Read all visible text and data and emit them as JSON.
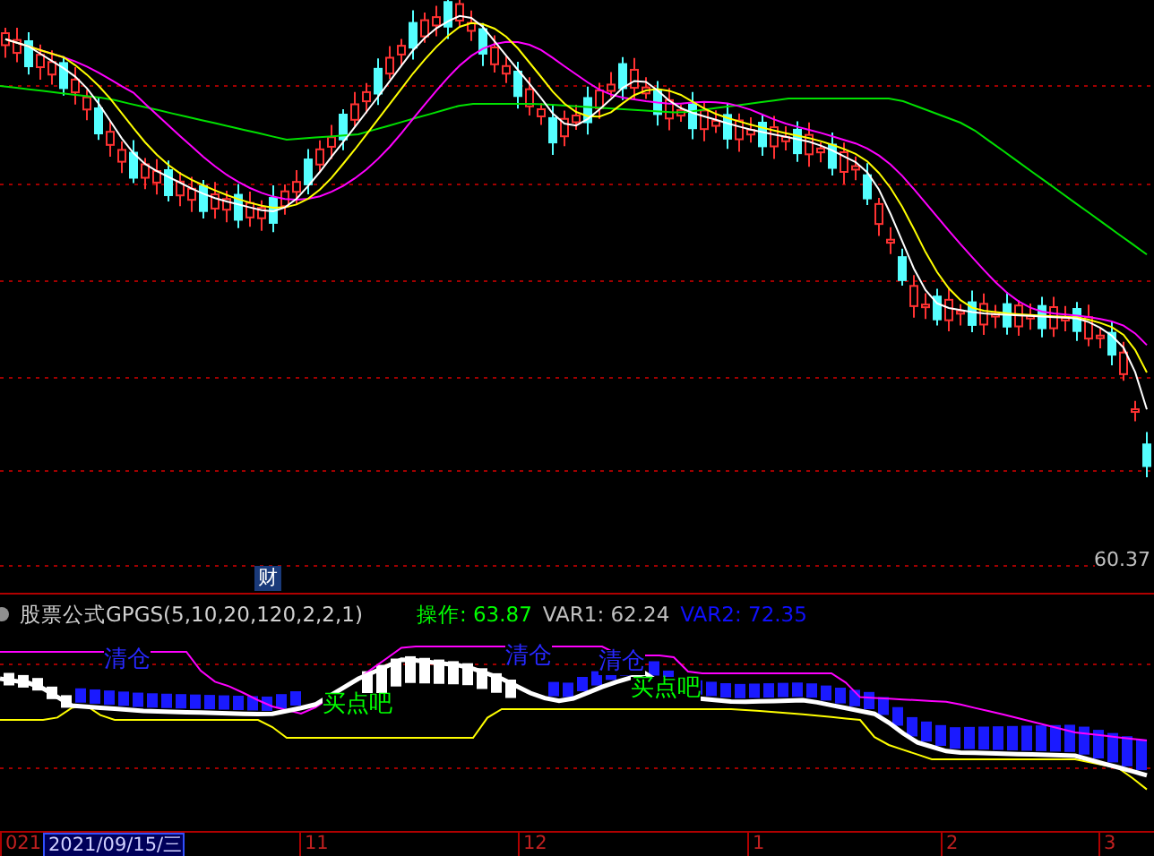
{
  "main_chart": {
    "price_label": "60.37",
    "marker": "财"
  },
  "indicator": {
    "name": "股票公式GPGS(5,10,20,120,2,2,1)",
    "values": [
      {
        "label": "操作: 63.87",
        "color": "#00ff00"
      },
      {
        "label": "VAR1: 62.24",
        "color": "#c0c0c0"
      },
      {
        "label": "VAR2: 72.35",
        "color": "#1010ff"
      }
    ],
    "signals": [
      {
        "text": "清仓",
        "kind": "sell"
      },
      {
        "text": "清仓",
        "kind": "sell"
      },
      {
        "text": "清仓",
        "kind": "sell"
      },
      {
        "text": "买点吧",
        "kind": "buy"
      },
      {
        "text": "买点吧",
        "kind": "buy"
      }
    ]
  },
  "time_axis": {
    "labels": [
      {
        "text": "021",
        "selected": false
      },
      {
        "text": "2021/09/15/三",
        "selected": true
      },
      {
        "text": "11",
        "selected": false
      },
      {
        "text": "12",
        "selected": false
      },
      {
        "text": "1",
        "selected": false
      },
      {
        "text": "2",
        "selected": false
      },
      {
        "text": "3",
        "selected": false
      }
    ]
  }
}
